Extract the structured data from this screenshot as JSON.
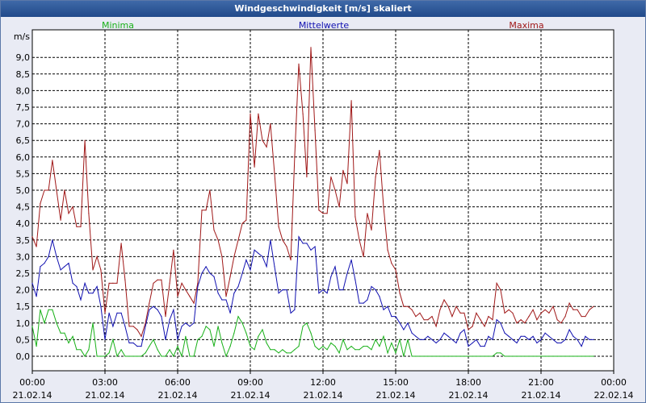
{
  "window": {
    "title": "Windgeschwindigkeit [m/s] skaliert"
  },
  "colors": {
    "minima": "#18b018",
    "mittelwerte": "#1010b0",
    "maxima": "#a01818",
    "grid": "#000000",
    "background": "#e9ebf4",
    "titlebar": "#2c5595"
  },
  "chart_data": {
    "type": "line",
    "title": "Windgeschwindigkeit [m/s] skaliert",
    "ylabel": "m/s",
    "xlabel": "",
    "ylim": [
      -0.5,
      9.6
    ],
    "yticks": [
      "0,0",
      "0,5",
      "1,0",
      "1,5",
      "2,0",
      "2,5",
      "3,0",
      "3,5",
      "4,0",
      "4,5",
      "5,0",
      "5,5",
      "6,0",
      "6,5",
      "7,0",
      "7,5",
      "8,0",
      "8,5",
      "9,0"
    ],
    "xticks": [
      {
        "time": "00:00",
        "date": "21.02.14"
      },
      {
        "time": "03:00",
        "date": "21.02.14"
      },
      {
        "time": "06:00",
        "date": "21.02.14"
      },
      {
        "time": "09:00",
        "date": "21.02.14"
      },
      {
        "time": "12:00",
        "date": "21.02.14"
      },
      {
        "time": "15:00",
        "date": "21.02.14"
      },
      {
        "time": "18:00",
        "date": "21.02.14"
      },
      {
        "time": "21:00",
        "date": "21.02.14"
      },
      {
        "time": "00:00",
        "date": "22.02.14"
      }
    ],
    "x_hours": [
      0,
      0.17,
      0.33,
      0.5,
      0.67,
      0.83,
      1,
      1.17,
      1.33,
      1.5,
      1.67,
      1.83,
      2,
      2.17,
      2.33,
      2.5,
      2.67,
      2.83,
      3,
      3.17,
      3.33,
      3.5,
      3.67,
      3.83,
      4,
      4.17,
      4.33,
      4.5,
      4.67,
      4.83,
      5,
      5.17,
      5.33,
      5.5,
      5.67,
      5.83,
      6,
      6.17,
      6.33,
      6.5,
      6.67,
      6.83,
      7,
      7.17,
      7.33,
      7.5,
      7.67,
      7.83,
      8,
      8.17,
      8.33,
      8.5,
      8.67,
      8.83,
      9,
      9.17,
      9.33,
      9.5,
      9.67,
      9.83,
      10,
      10.17,
      10.33,
      10.5,
      10.67,
      10.83,
      11,
      11.17,
      11.33,
      11.5,
      11.67,
      11.83,
      12,
      12.17,
      12.33,
      12.5,
      12.67,
      12.83,
      13,
      13.17,
      13.33,
      13.5,
      13.67,
      13.83,
      14,
      14.17,
      14.33,
      14.5,
      14.67,
      14.83,
      15,
      15.17,
      15.33,
      15.5,
      15.67,
      15.83,
      16,
      16.17,
      16.33,
      16.5,
      16.67,
      16.83,
      17,
      17.17,
      17.33,
      17.5,
      17.67,
      17.83,
      18,
      18.17,
      18.33,
      18.5,
      18.67,
      18.83,
      19,
      19.17,
      19.33,
      19.5,
      19.67,
      19.83,
      20,
      20.17,
      20.33,
      20.5,
      20.67,
      20.83,
      21,
      21.17,
      21.33,
      21.5,
      21.67,
      21.83,
      22,
      22.17,
      22.33,
      22.5,
      22.67,
      22.83,
      23,
      23.17,
      23.33,
      23.5,
      23.67,
      23.83,
      24
    ],
    "series": [
      {
        "name": "Maxima",
        "color": "#a01818",
        "values": [
          3.6,
          3.3,
          4.6,
          5.0,
          5.0,
          5.9,
          5.0,
          4.1,
          5.0,
          4.3,
          4.5,
          3.9,
          3.9,
          6.5,
          4.3,
          2.6,
          3.0,
          2.6,
          1.3,
          2.2,
          2.2,
          2.2,
          3.4,
          2.3,
          0.9,
          0.9,
          0.8,
          0.6,
          1.0,
          1.6,
          2.2,
          2.3,
          2.3,
          1.2,
          2.2,
          3.2,
          1.8,
          2.2,
          2.0,
          1.8,
          1.6,
          2.2,
          4.4,
          4.4,
          5.0,
          3.8,
          3.5,
          3.0,
          1.8,
          2.4,
          3.0,
          3.5,
          4.0,
          4.1,
          7.3,
          5.7,
          7.3,
          6.5,
          6.3,
          7.0,
          5.5,
          3.9,
          3.5,
          3.3,
          2.9,
          6.0,
          8.8,
          7.3,
          5.4,
          9.3,
          6.8,
          4.4,
          4.3,
          4.3,
          5.4,
          5.0,
          4.5,
          5.6,
          5.2,
          7.7,
          4.2,
          3.5,
          3.0,
          4.3,
          3.8,
          5.4,
          6.2,
          4.5,
          3.2,
          2.8,
          2.6,
          1.9,
          1.5,
          1.5,
          1.4,
          1.2,
          1.3,
          1.1,
          1.1,
          1.2,
          0.9,
          1.4,
          1.7,
          1.5,
          1.2,
          1.5,
          1.3,
          1.3,
          0.8,
          0.9,
          1.3,
          1.1,
          0.9,
          1.2,
          1.1,
          2.2,
          2.0,
          1.3,
          1.4,
          1.3,
          1.0,
          1.1,
          1.0,
          1.2,
          1.4,
          1.1,
          1.3,
          1.4,
          1.3,
          1.5,
          1.1,
          1.0,
          1.2,
          1.6,
          1.4,
          1.4,
          1.2,
          1.2,
          1.4,
          1.5
        ]
      },
      {
        "name": "Mittelwerte",
        "color": "#1010b0",
        "values": [
          2.2,
          1.8,
          2.7,
          2.8,
          3.0,
          3.5,
          3.0,
          2.6,
          2.7,
          2.8,
          2.2,
          2.1,
          1.7,
          2.2,
          1.9,
          1.9,
          2.1,
          1.5,
          0.5,
          1.3,
          0.9,
          1.3,
          1.3,
          0.9,
          0.4,
          0.4,
          0.3,
          0.3,
          0.9,
          1.4,
          1.5,
          1.4,
          1.2,
          0.5,
          1.1,
          1.4,
          0.5,
          0.9,
          1.0,
          0.9,
          1.0,
          2.1,
          2.5,
          2.7,
          2.5,
          2.4,
          1.9,
          1.7,
          1.7,
          1.3,
          1.9,
          2.1,
          2.5,
          2.9,
          2.6,
          3.2,
          3.1,
          3.0,
          2.7,
          3.5,
          2.7,
          1.9,
          2.0,
          2.0,
          1.3,
          1.4,
          3.6,
          3.4,
          3.4,
          3.2,
          3.3,
          1.9,
          2.0,
          1.9,
          2.4,
          2.7,
          2.0,
          2.0,
          2.5,
          2.9,
          2.3,
          1.6,
          1.6,
          1.7,
          2.1,
          2.0,
          1.8,
          1.4,
          1.5,
          1.2,
          1.2,
          1.0,
          0.8,
          1.0,
          0.7,
          0.6,
          0.5,
          0.5,
          0.6,
          0.5,
          0.4,
          0.5,
          0.7,
          0.6,
          0.5,
          0.4,
          0.7,
          0.8,
          0.3,
          0.4,
          0.5,
          0.3,
          0.3,
          0.6,
          0.5,
          1.1,
          1.0,
          0.7,
          0.6,
          0.5,
          0.4,
          0.6,
          0.6,
          0.5,
          0.6,
          0.4,
          0.5,
          0.7,
          0.6,
          0.5,
          0.4,
          0.4,
          0.5,
          0.8,
          0.6,
          0.5,
          0.3,
          0.6,
          0.5,
          0.5
        ]
      },
      {
        "name": "Minima",
        "color": "#18b018",
        "values": [
          0.9,
          0.3,
          1.4,
          1.0,
          1.4,
          1.4,
          1.0,
          0.7,
          0.7,
          0.4,
          0.6,
          0.2,
          0.2,
          0.0,
          0.2,
          1.0,
          0.0,
          0.0,
          0.0,
          0.1,
          0.5,
          0.0,
          0.2,
          0.0,
          0.0,
          0.0,
          0.0,
          0.0,
          0.1,
          0.3,
          0.5,
          0.2,
          0.0,
          0.0,
          0.2,
          0.0,
          0.3,
          0.0,
          0.6,
          0.0,
          0.0,
          0.5,
          0.6,
          0.9,
          0.8,
          0.3,
          0.9,
          0.4,
          0.0,
          0.3,
          0.7,
          1.2,
          1.0,
          0.7,
          0.3,
          0.2,
          0.6,
          0.8,
          0.4,
          0.2,
          0.2,
          0.1,
          0.2,
          0.1,
          0.1,
          0.2,
          0.3,
          0.9,
          1.0,
          0.7,
          0.3,
          0.2,
          0.3,
          0.2,
          0.4,
          0.3,
          0.1,
          0.5,
          0.2,
          0.3,
          0.2,
          0.2,
          0.3,
          0.3,
          0.2,
          0.5,
          0.3,
          0.6,
          0.1,
          0.4,
          0.1,
          0.5,
          0.0,
          0.5,
          0.0,
          0.0,
          0.0,
          0.0,
          0.0,
          0.0,
          0.0,
          0.0,
          0.0,
          0.0,
          0.0,
          0.0,
          0.0,
          0.0,
          0.0,
          0.0,
          0.0,
          0.0,
          0.0,
          0.0,
          0.0,
          0.1,
          0.1,
          0.0,
          0.0,
          0.0,
          0.0,
          0.0,
          0.0,
          0.0,
          0.0,
          0.0,
          0.0,
          0.0,
          0.0,
          0.0,
          0.0,
          0.0,
          0.0,
          0.0,
          0.0,
          0.0,
          0.0,
          0.0,
          0.0,
          0.0
        ]
      }
    ],
    "legend": {
      "placement": "top",
      "items": [
        "Minima",
        "Mittelwerte",
        "Maxima"
      ]
    },
    "grid": true
  }
}
